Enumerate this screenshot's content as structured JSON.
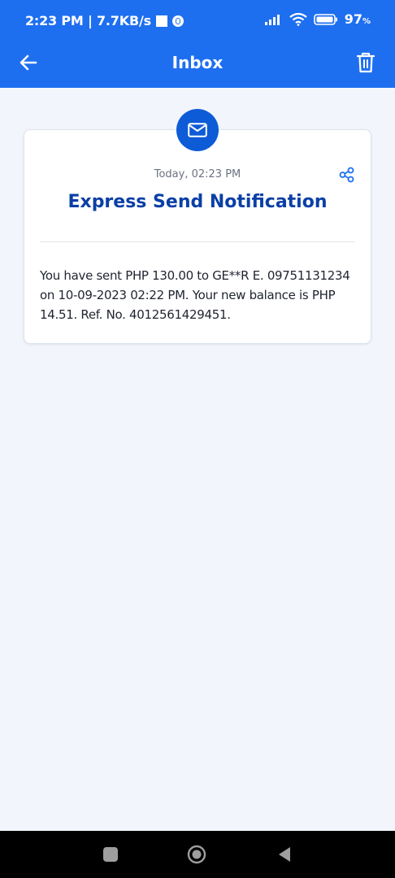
{
  "status_bar": {
    "time_speed": "2:23 PM | 7.7KB/s",
    "battery": "97"
  },
  "app_bar": {
    "title": "Inbox",
    "back_icon": "arrow-left-icon",
    "delete_icon": "trash-icon"
  },
  "notification": {
    "icon": "mail-icon",
    "timestamp": "Today, 02:23 PM",
    "share_icon": "share-icon",
    "title": "Express Send Notification",
    "message": "You have sent PHP 130.00 to GE**R E. 09751131234 on 10-09-2023 02:22 PM. Your new balance is PHP 14.51. Ref. No. 4012561429451."
  },
  "colors": {
    "primary": "#1E6FF0",
    "title": "#0A3FA6",
    "background": "#F2F6FC"
  }
}
